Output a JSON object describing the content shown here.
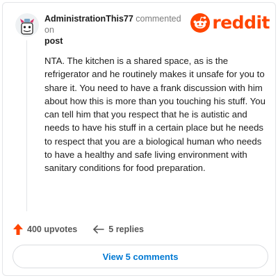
{
  "comment": {
    "username": "AdministrationThis77",
    "action_text": "commented on",
    "post_link": "post",
    "body": "NTA. The kitchen is a shared space, as is the refrigerator and he routinely makes it unsafe for you to share it. You need to have a frank discussion with him about how this is more than you touching his stuff. You can tell him that you respect that he is autistic and needs to have his stuff in a certain place but he needs to respect that you are a biological human who needs to have a healthy and safe living environment with sanitary conditions for food preparation."
  },
  "brand": {
    "wordmark": "reddit",
    "color": "#ff4500"
  },
  "actions": {
    "upvotes": "400 upvotes",
    "upvote_icon": "upvote-arrow-icon",
    "replies": "5 replies",
    "reply_icon": "reply-arrow-icon"
  },
  "footer": {
    "view_comments_label": "View 5 comments"
  },
  "colors": {
    "upvote": "#ff4500",
    "link": "#0079d3",
    "muted": "#7c7c7c"
  }
}
